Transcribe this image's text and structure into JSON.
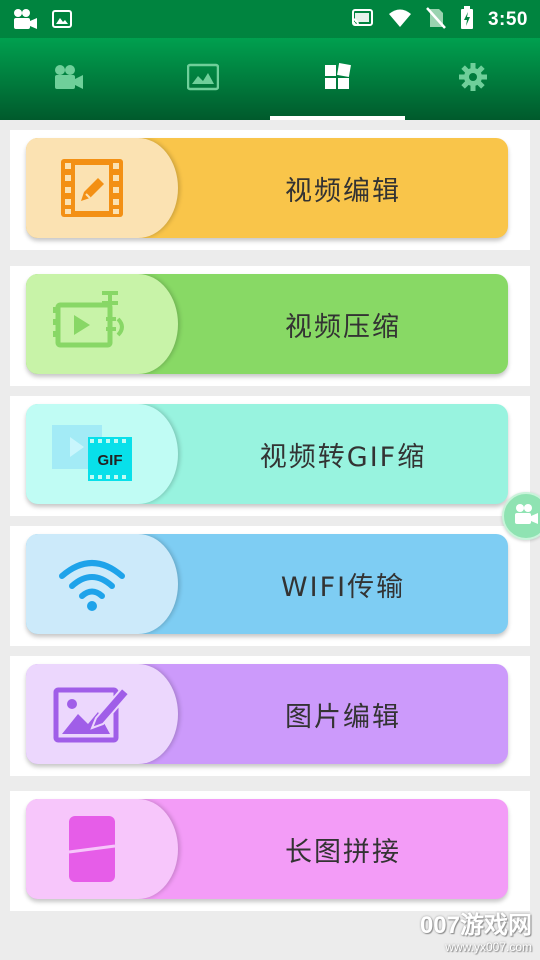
{
  "status_bar": {
    "time": "3:50",
    "icons": [
      "video-camera-icon",
      "image-icon",
      "cast-icon",
      "wifi-icon",
      "no-sim-icon",
      "battery-charging-icon"
    ]
  },
  "tabs": [
    {
      "icon": "video-camera-icon",
      "active": false
    },
    {
      "icon": "picture-icon",
      "active": false
    },
    {
      "icon": "grid-apps-icon",
      "active": true
    },
    {
      "icon": "settings-gear-icon",
      "active": false
    }
  ],
  "menu": [
    {
      "label": "视频编辑",
      "icon": "video-edit-icon",
      "icon_bg": "#fbe2b2",
      "bg": "#f9c54a"
    },
    {
      "label": "视频压缩",
      "icon": "video-compress-icon",
      "icon_bg": "#c8f3a8",
      "bg": "#88d965"
    },
    {
      "label": "视频转GIF缩",
      "icon": "video-to-gif-icon",
      "icon_bg": "#c0fcf4",
      "bg": "#98f3df",
      "gif_text": "GIF"
    },
    {
      "label": "WIFI传输",
      "icon": "wifi-transfer-icon",
      "icon_bg": "#cceafa",
      "bg": "#7ecdf3"
    },
    {
      "label": "图片编辑",
      "icon": "image-edit-icon",
      "icon_bg": "#ecd7fd",
      "bg": "#cc9afb"
    },
    {
      "label": "长图拼接",
      "icon": "long-image-stitch-icon",
      "icon_bg": "#f7c6fb",
      "bg": "#f39cf7"
    }
  ],
  "floating_button": {
    "icon": "video-camera-icon"
  },
  "watermark": {
    "brand": "007游戏网",
    "url": "www.yx007.com"
  }
}
